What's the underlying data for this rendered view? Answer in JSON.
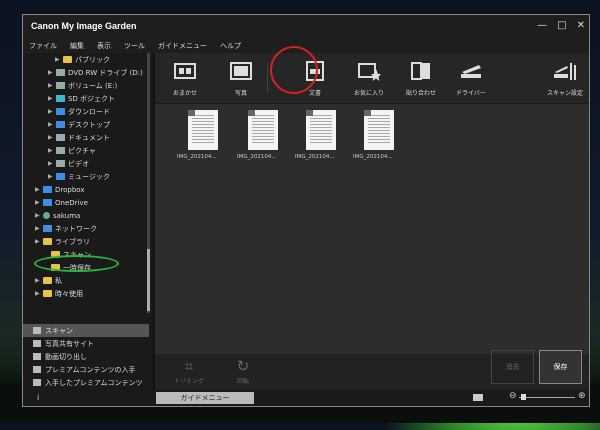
{
  "window": {
    "title": "Canon My Image Garden",
    "controls": [
      "—",
      "□",
      "✕"
    ]
  },
  "menu": [
    "ファイル",
    "編集",
    "表示",
    "ツール",
    "ガイドメニュー",
    "ヘルプ"
  ],
  "tree": [
    {
      "label": "パブリック",
      "icon": "folder-icon",
      "expander": true
    },
    {
      "label": "DVD RW ドライブ (D:)",
      "icon": "dvd-drive-icon",
      "expander": true
    },
    {
      "label": "ボリューム (E:)",
      "icon": "drive-icon",
      "expander": true
    },
    {
      "label": "SD ボジェクト",
      "icon": "3d-objects-icon",
      "expander": true
    },
    {
      "label": "ダウンロード",
      "icon": "download-icon",
      "expander": true
    },
    {
      "label": "デスクトップ",
      "icon": "desktop-icon",
      "expander": true
    },
    {
      "label": "ドキュメント",
      "icon": "documents-icon",
      "expander": true
    },
    {
      "label": "ピクチャ",
      "icon": "pictures-icon",
      "expander": true
    },
    {
      "label": "ビデオ",
      "icon": "videos-icon",
      "expander": true
    },
    {
      "label": "ミュージック",
      "icon": "music-icon",
      "expander": true
    },
    {
      "label": "Dropbox",
      "icon": "dropbox-icon",
      "expander": true
    },
    {
      "label": "OneDrive",
      "icon": "onedrive-icon",
      "expander": true
    },
    {
      "label": "sakuma",
      "icon": "user-icon",
      "expander": true
    },
    {
      "label": "ネットワーク",
      "icon": "network-icon",
      "expander": true
    },
    {
      "label": "ライブラリ",
      "icon": "library-icon",
      "expander": true
    },
    {
      "label": "スキャン",
      "icon": "folder-icon",
      "expander": false
    },
    {
      "label": "一時保存",
      "icon": "folder-icon",
      "expander": false
    },
    {
      "label": "私",
      "icon": "folder-icon",
      "expander": true
    },
    {
      "label": "時々使用",
      "icon": "folder-icon",
      "expander": true
    }
  ],
  "sidemenu": [
    {
      "label": "スキャン",
      "icon": "scan-icon",
      "selected": true
    },
    {
      "label": "写真共有サイト",
      "icon": "photo-share-icon",
      "selected": false
    },
    {
      "label": "動画切り出し",
      "icon": "video-cut-icon",
      "selected": false
    },
    {
      "label": "プレミアムコンテンツの入手",
      "icon": "premium-content-icon",
      "selected": false
    },
    {
      "label": "入手したプレミアムコンテンツ",
      "icon": "downloaded-content-icon",
      "selected": false
    }
  ],
  "toolbar": [
    {
      "label": "おまかせ",
      "icon": "auto-scan-icon"
    },
    {
      "label": "写真",
      "icon": "photo-scan-icon"
    },
    {
      "label": "文書",
      "icon": "document-scan-icon"
    },
    {
      "label": "お気に入り",
      "icon": "favorites-scan-icon"
    },
    {
      "label": "貼り合わせ",
      "icon": "stitch-icon"
    },
    {
      "label": "ドライバー",
      "icon": "driver-icon"
    },
    {
      "label": "スキャン設定",
      "icon": "scan-settings-icon"
    }
  ],
  "thumbnails": [
    "IMG_202104...",
    "IMG_202104...",
    "IMG_202104...",
    "IMG_202104..."
  ],
  "bottom_tools": [
    {
      "label": "トリミング",
      "icon": "crop-icon"
    },
    {
      "label": "回転",
      "icon": "rotate-icon"
    }
  ],
  "buttons": {
    "cancel": "消去",
    "save": "保存",
    "guide": "ガイドメニュー"
  },
  "status": {
    "info_glyph": "i"
  },
  "colors": {
    "highlight_red": "#d32020",
    "highlight_green": "#27b43b"
  }
}
